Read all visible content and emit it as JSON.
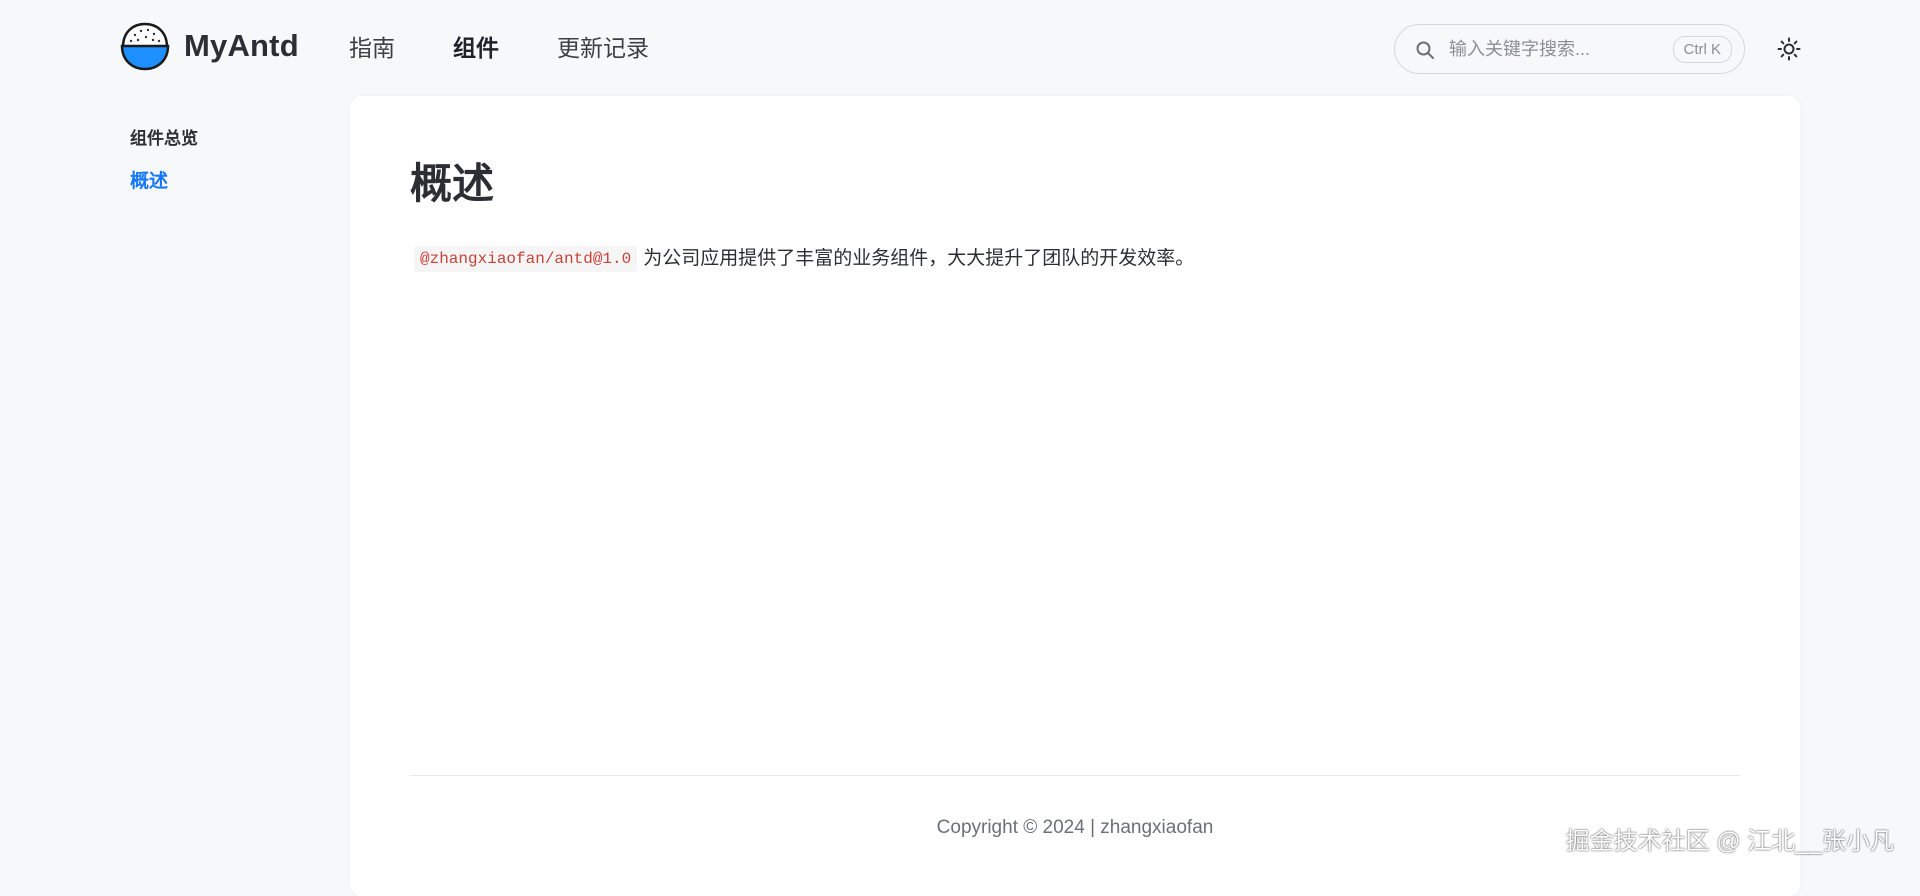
{
  "header": {
    "brand": "MyAntd",
    "logo_icon": "rice-bowl-icon",
    "nav": [
      {
        "label": "指南",
        "active": false
      },
      {
        "label": "组件",
        "active": true
      },
      {
        "label": "更新记录",
        "active": false
      }
    ],
    "search": {
      "placeholder": "输入关键字搜索...",
      "value": "",
      "shortcut": "Ctrl K",
      "icon": "search-icon"
    },
    "theme_toggle_icon": "sun-icon"
  },
  "sidebar": {
    "group_title": "组件总览",
    "items": [
      {
        "label": "概述",
        "active": true
      }
    ]
  },
  "main": {
    "title": "概述",
    "package_code": "@zhangxiaofan/antd@1.0",
    "description": "为公司应用提供了丰富的业务组件，大大提升了团队的开发效率。",
    "footer": "Copyright © 2024 | zhangxiaofan"
  },
  "watermark": "掘金技术社区 @ 江北__张小凡",
  "colors": {
    "accent": "#1677ff",
    "code_text": "#c8423a",
    "page_bg": "#f7f8fa",
    "card_bg": "#ffffff"
  }
}
